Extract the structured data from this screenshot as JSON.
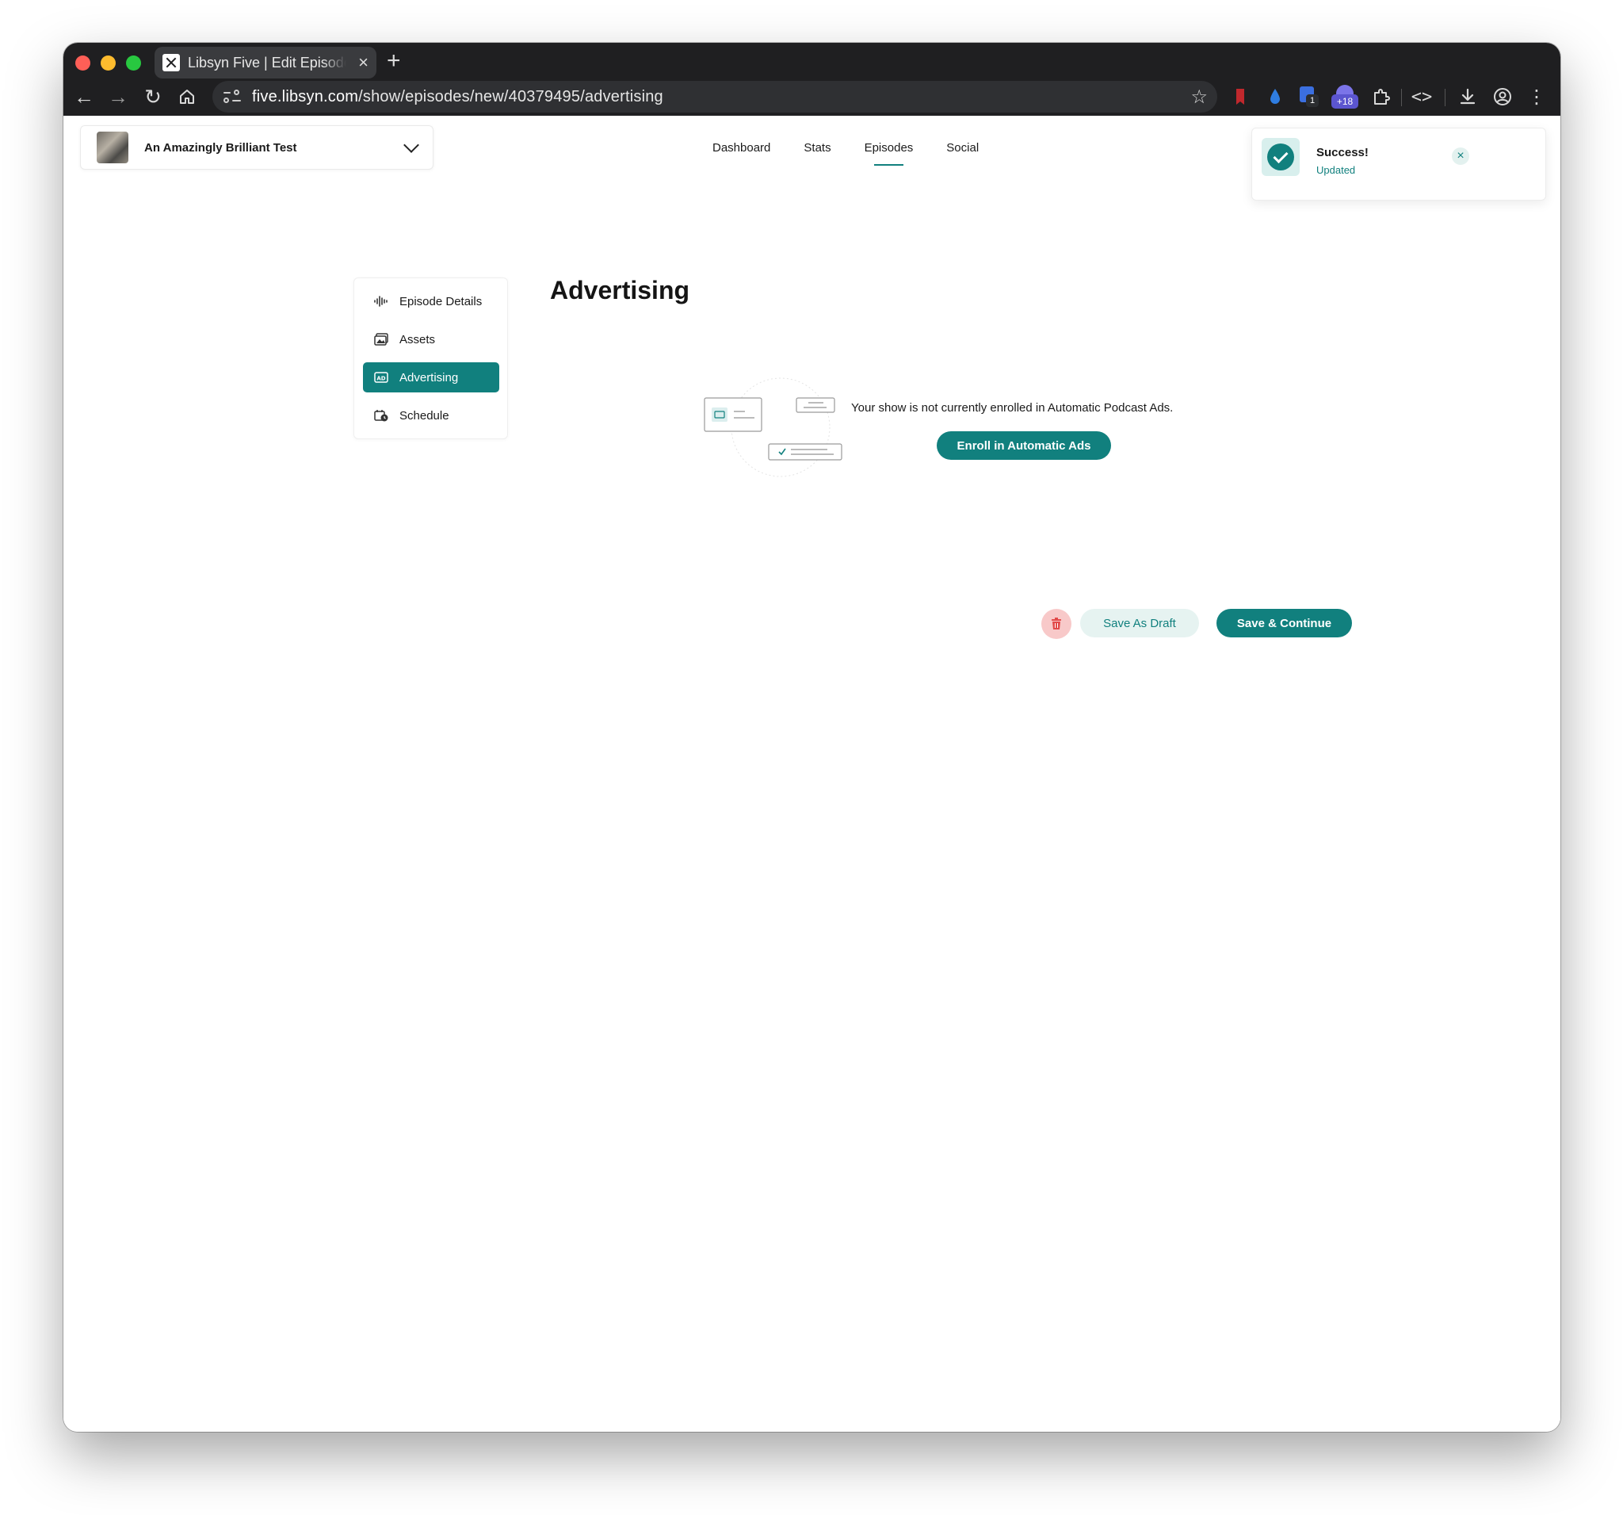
{
  "browser": {
    "tab_title": "Libsyn Five | Edit Episode",
    "url_host": "five.libsyn.com",
    "url_path": "/show/episodes/new/40379495/advertising",
    "extension_badge_1": "1",
    "extension_badge_2": "+18"
  },
  "header": {
    "show_name": "An Amazingly Brilliant Test",
    "nav": [
      "Dashboard",
      "Stats",
      "Episodes",
      "Social"
    ],
    "active_nav": "Episodes"
  },
  "toast": {
    "title": "Success!",
    "message": "Updated",
    "close_icon": "×"
  },
  "sidebar": {
    "items": [
      {
        "label": "Episode Details",
        "icon": "waveform-icon"
      },
      {
        "label": "Assets",
        "icon": "image-icon"
      },
      {
        "label": "Advertising",
        "icon": "ad-icon",
        "active": true
      },
      {
        "label": "Schedule",
        "icon": "calendar-clock-icon"
      }
    ]
  },
  "main": {
    "title": "Advertising",
    "notice": "Your show is not currently enrolled in Automatic Podcast Ads.",
    "enroll_label": "Enroll in Automatic Ads"
  },
  "actions": {
    "draft_label": "Save As Draft",
    "continue_label": "Save & Continue"
  },
  "colors": {
    "brand": "#11807e",
    "danger_bg": "#f8c9c9",
    "danger": "#e24a4a"
  }
}
